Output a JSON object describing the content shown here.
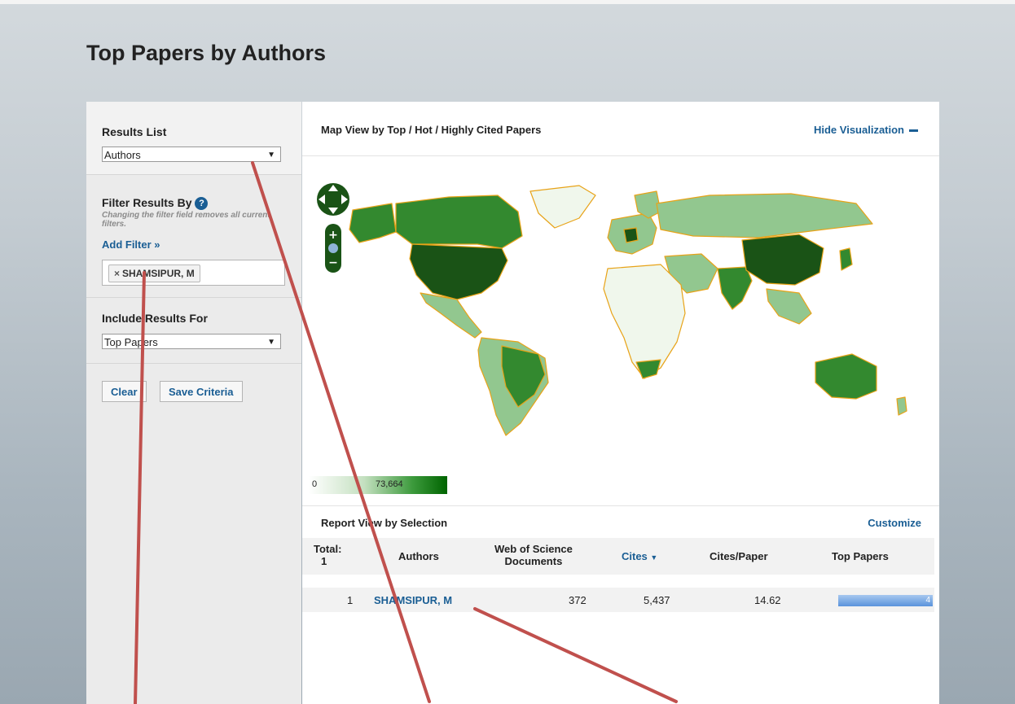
{
  "page": {
    "title": "Top Papers by Authors"
  },
  "sidebar": {
    "results_list": {
      "label": "Results List",
      "selected": "Authors"
    },
    "filter": {
      "label": "Filter Results By",
      "hint": "Changing the filter field removes all current filters.",
      "add_filter": "Add Filter »",
      "chips": [
        "SHAMSIPUR, M"
      ]
    },
    "include": {
      "label": "Include Results For",
      "selected": "Top Papers"
    },
    "buttons": {
      "clear": "Clear",
      "save": "Save Criteria"
    }
  },
  "visualization": {
    "title": "Map View by Top / Hot / Highly Cited Papers",
    "hide_label": "Hide Visualization",
    "legend": {
      "min": "0",
      "max": "73,664"
    },
    "colors": {
      "low": "#f0f7ec",
      "mid": "#92c78f",
      "high": "#33892f",
      "top": "#1a5316",
      "border": "#e8a318"
    }
  },
  "report": {
    "title": "Report View by Selection",
    "customize": "Customize",
    "headers": {
      "total": "Total:",
      "total_count": "1",
      "authors": "Authors",
      "wos_line1": "Web of Science",
      "wos_line2": "Documents",
      "cites": "Cites",
      "cites_per_paper": "Cites/Paper",
      "top_papers": "Top Papers"
    },
    "rows": [
      {
        "rank": "1",
        "author": "SHAMSIPUR, M",
        "documents": "372",
        "cites": "5,437",
        "cites_per_paper": "14.62",
        "top_papers": "4"
      }
    ]
  }
}
